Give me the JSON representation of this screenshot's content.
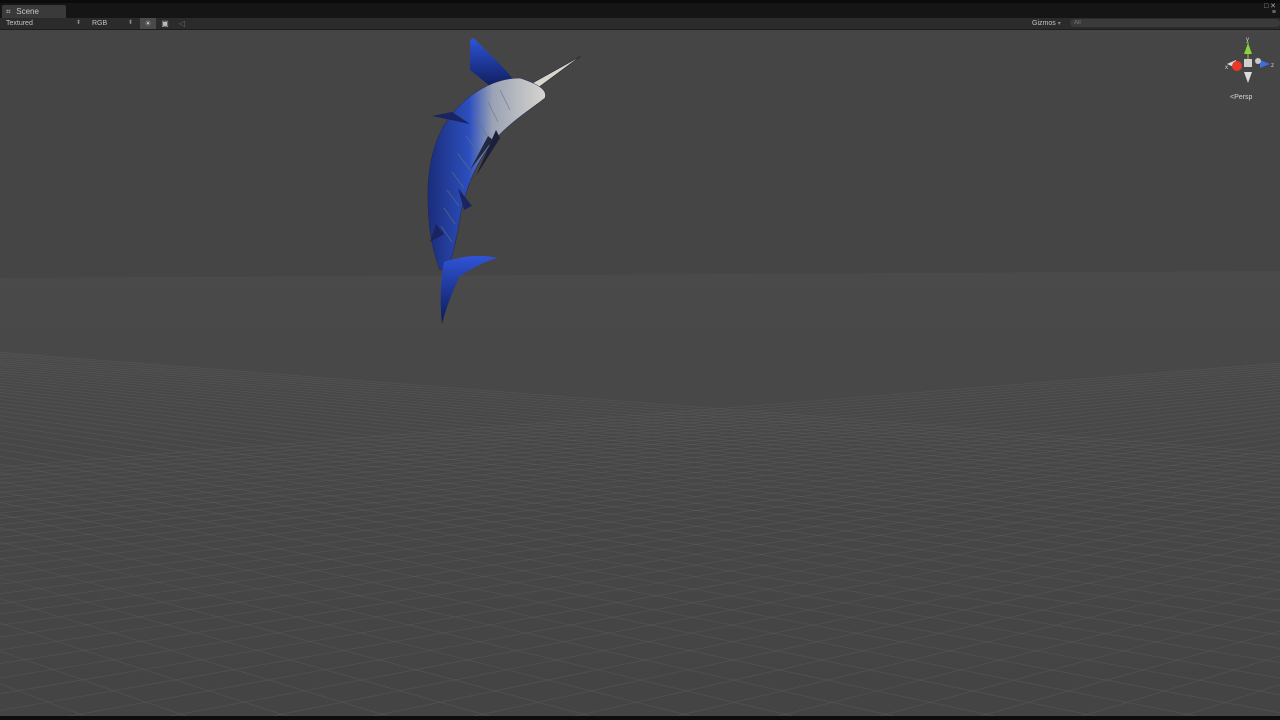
{
  "tab": {
    "label": "Scene",
    "icon": "scene-grid-icon"
  },
  "toolbar": {
    "draw_mode": "Textured",
    "render_mode": "RGB",
    "scene_lighting_icon": "sun-icon",
    "scene_overlay_icon": "image-icon",
    "audio_icon": "speaker-icon",
    "gizmos_label": "Gizmos",
    "search_placeholder": "All"
  },
  "window_controls": {
    "maximize_icon": "maximize-icon",
    "close_icon": "close-icon",
    "menu_icon": "menu-icon"
  },
  "viewport": {
    "object": "marlin-model",
    "axis_labels": {
      "y": "y",
      "x": "x",
      "z": "z"
    },
    "projection_label": "Persp",
    "colors": {
      "background": "#454545",
      "grid": "#6a6a6a",
      "axis_x": "#e8382a",
      "axis_y": "#8cd23c",
      "axis_z": "#3a6fe0"
    }
  }
}
